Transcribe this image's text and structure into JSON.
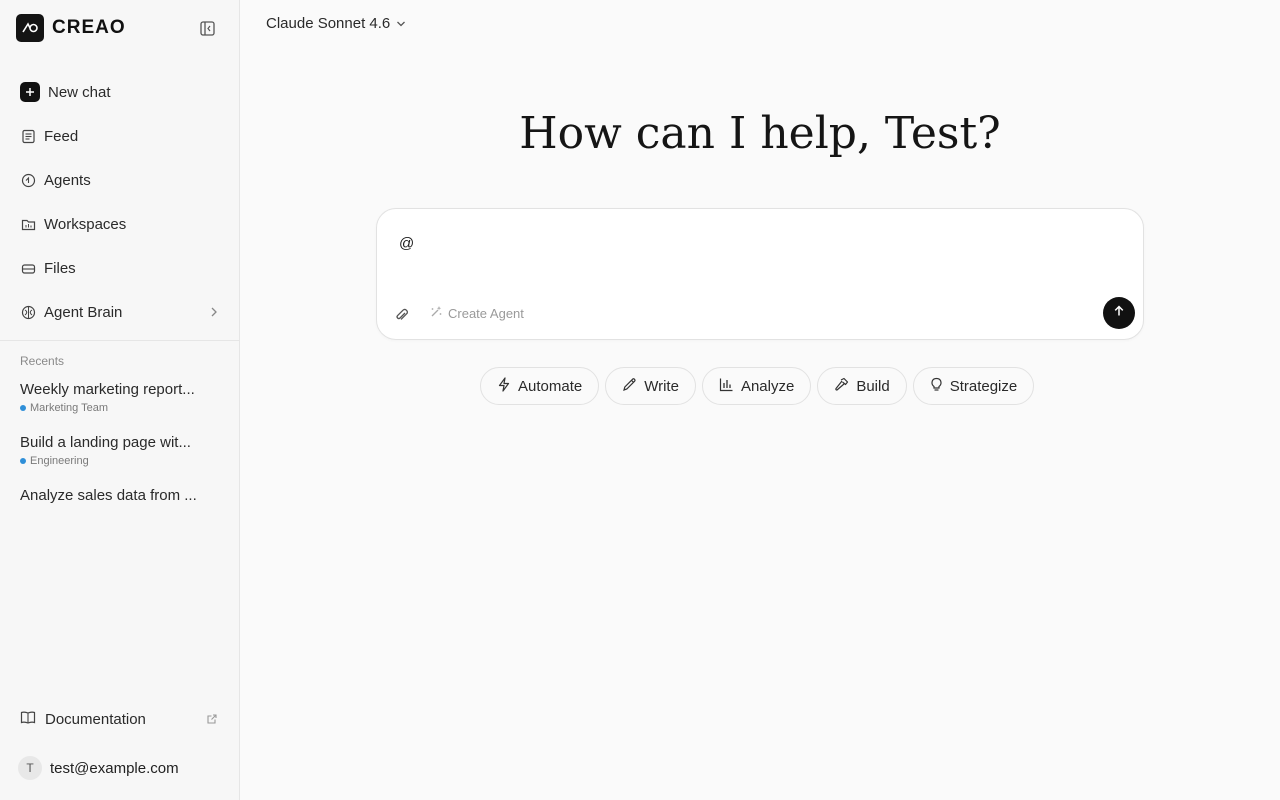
{
  "brand": {
    "name": "CREAO"
  },
  "nav": {
    "new_chat": "New chat",
    "feed": "Feed",
    "agents": "Agents",
    "workspaces": "Workspaces",
    "files": "Files",
    "agent_brain": "Agent Brain"
  },
  "recents": {
    "label": "Recents",
    "items": [
      {
        "title": "Weekly marketing report...",
        "tag": "Marketing Team"
      },
      {
        "title": "Build a landing page wit...",
        "tag": "Engineering"
      },
      {
        "title": "Analyze sales data from ...",
        "tag": ""
      }
    ]
  },
  "footer": {
    "documentation": "Documentation",
    "avatar_initial": "T",
    "email": "test@example.com"
  },
  "main": {
    "model": "Claude Sonnet 4.6",
    "greeting": "How can I help, Test?",
    "composer_value": "@",
    "create_agent": "Create Agent",
    "chips": [
      "Automate",
      "Write",
      "Analyze",
      "Build",
      "Strategize"
    ]
  },
  "colors": {
    "accent_dark": "#111111",
    "tag_dot": "#2f8fd8"
  }
}
